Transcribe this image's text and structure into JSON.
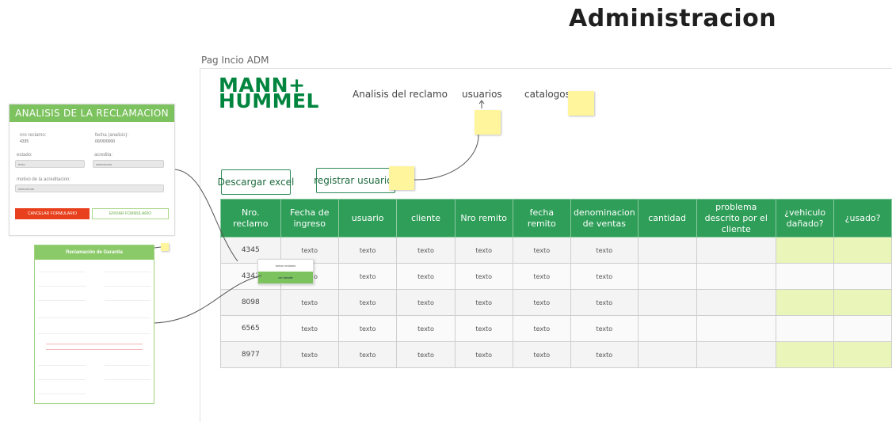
{
  "board": {
    "title": "Administracion",
    "frame_label": "Pag Incio ADM"
  },
  "header": {
    "logo_line1": "MANN+",
    "logo_line2": "HUMMEL",
    "nav": [
      "Analisis del reclamo",
      "usuarios",
      "catalogos"
    ]
  },
  "toolbar": {
    "download_label": "Descargar excel",
    "register_label": "registrar usuarios"
  },
  "table": {
    "columns": [
      "Nro. reclamo",
      "Fecha de ingreso",
      "usuario",
      "cliente",
      "Nro remito",
      "fecha remito",
      "denominacion de ventas",
      "cantidad",
      "problema descrito por el cliente",
      "¿vehiculo dañado?",
      "¿usado?"
    ],
    "rows": [
      {
        "nro": "4345",
        "fecha": "texto",
        "usuario": "texto",
        "cliente": "texto",
        "remito": "texto",
        "fecha_remito": "texto",
        "denominacion": "texto"
      },
      {
        "nro": "4343",
        "fecha": "texto",
        "usuario": "texto",
        "cliente": "texto",
        "remito": "texto",
        "fecha_remito": "texto",
        "denominacion": "texto"
      },
      {
        "nro": "8098",
        "fecha": "texto",
        "usuario": "texto",
        "cliente": "texto",
        "remito": "texto",
        "fecha_remito": "texto",
        "denominacion": "texto"
      },
      {
        "nro": "6565",
        "fecha": "texto",
        "usuario": "texto",
        "cliente": "texto",
        "remito": "texto",
        "fecha_remito": "texto",
        "denominacion": "texto"
      },
      {
        "nro": "8977",
        "fecha": "texto",
        "usuario": "texto",
        "cliente": "texto",
        "remito": "texto",
        "fecha_remito": "texto",
        "denominacion": "texto"
      }
    ],
    "highlight_color": "#e9f5b9",
    "header_color": "#2e9e58"
  },
  "context_menu": {
    "items": [
      "tomar reclamo",
      "ver detalle"
    ]
  },
  "analysis_panel": {
    "title": "ANALISIS DE LA RECLAMACION",
    "nro_label": "nro reclamo:",
    "nro_value": "4335",
    "fecha_label": "fecha (analisis):",
    "fecha_value": "00/00/0000",
    "estado_label": "estado:",
    "estado_value": "texto",
    "acredita_label": "acredita:",
    "acredita_value": "seleccionar",
    "motivo_label": "motivo de la acreditacion:",
    "motivo_value": "seleccionar",
    "cancel_label": "CANCELAR FORMULARIO",
    "send_label": "ENVIAR FORMULARIO"
  },
  "garantia_form": {
    "title": "Reclamación de Garantía"
  },
  "colors": {
    "brand_green": "#00853e",
    "accent_green": "#7cc25e",
    "cancel_red": "#e8401c",
    "sticky_yellow": "#fff59d"
  }
}
